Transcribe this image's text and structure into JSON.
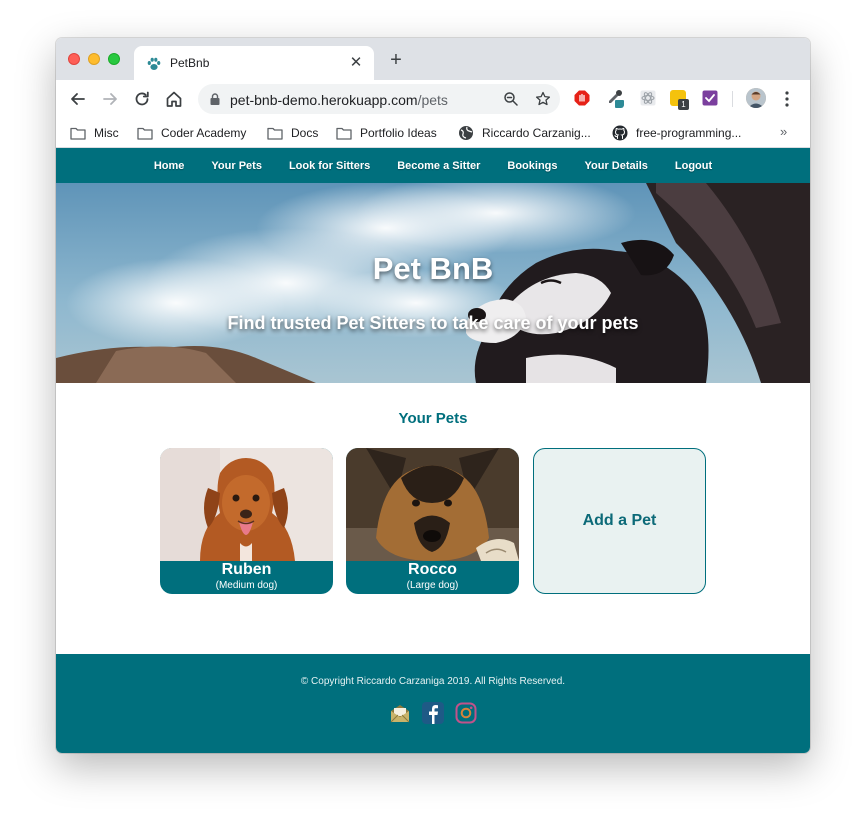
{
  "browser": {
    "tab_title": "PetBnb",
    "url_host": "pet-bnb-demo.herokuapp.com",
    "url_path": "/pets",
    "extension_badge": "1"
  },
  "bookmarks": [
    {
      "label": "Misc",
      "icon": "folder-icon"
    },
    {
      "label": "Coder Academy",
      "icon": "folder-icon"
    },
    {
      "label": "Docs",
      "icon": "folder-icon"
    },
    {
      "label": "Portfolio Ideas",
      "icon": "folder-icon"
    },
    {
      "label": "Riccardo Carzanig...",
      "icon": "globe-icon"
    },
    {
      "label": "free-programming...",
      "icon": "github-icon"
    }
  ],
  "nav": {
    "items": [
      "Home",
      "Your Pets",
      "Look for Sitters",
      "Become a Sitter",
      "Bookings",
      "Your Details",
      "Logout"
    ]
  },
  "hero": {
    "title": "Pet BnB",
    "subtitle": "Find trusted Pet Sitters to take care of your pets"
  },
  "pets_section": {
    "title": "Your Pets",
    "pets": [
      {
        "name": "Ruben",
        "size": "(Medium dog)"
      },
      {
        "name": "Rocco",
        "size": "(Large dog)"
      }
    ],
    "add_label": "Add a Pet"
  },
  "footer": {
    "copyright": "© Copyright Riccardo Carzaniga 2019. All Rights Reserved.",
    "social": [
      "email-icon",
      "facebook-icon",
      "instagram-icon"
    ]
  },
  "colors": {
    "brand": "#006f7d",
    "add_card_bg": "#e9f2f1"
  }
}
